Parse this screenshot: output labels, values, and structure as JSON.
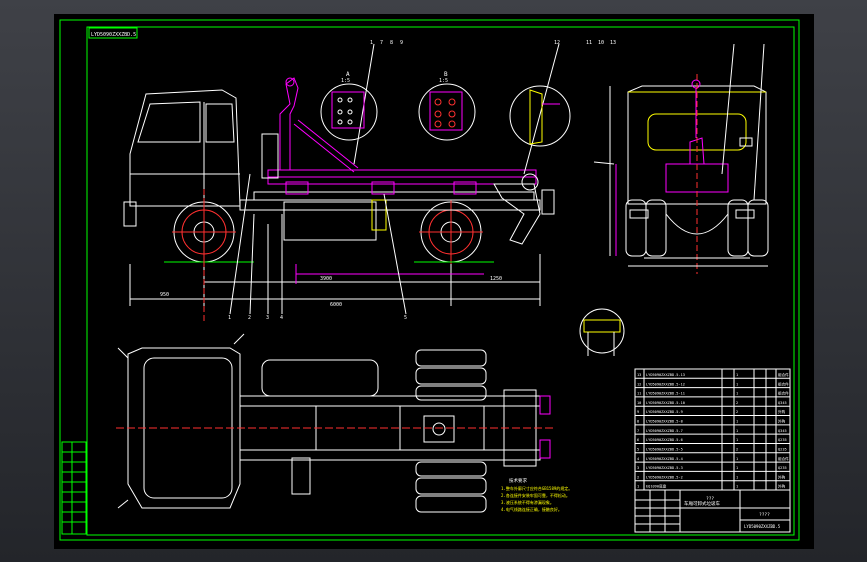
{
  "drawing": {
    "code_box": "LYD5090ZXXZBD.5",
    "detail_a": "A",
    "detail_b": "B",
    "scale": "1:5",
    "view_labels": [
      "1",
      "2",
      "3",
      "4",
      "5"
    ],
    "balloons_top_left": [
      "1",
      "7",
      "8",
      "9"
    ],
    "balloons_top_right": [
      "12",
      "11",
      "10",
      "13"
    ],
    "side_dims": [
      "950",
      "3900",
      "1250",
      "6000"
    ],
    "notes_title": "技术要求",
    "notes": [
      "1.整车外廓尺寸应符合GB1589的规定。",
      "2.各连接件安装牢固可靠，不得松动。",
      "3.液压系统不得有渗漏现象。",
      "4.电气线路连接正确，接触良好。"
    ],
    "title_block": {
      "name": "车厢可卸式垃圾车",
      "drawing_no": "LYD5090ZXXZBD.5",
      "marks": "???",
      "code": "????"
    },
    "bom_rows": [
      [
        "13",
        "LYD5090ZXXZBD.5-13",
        "拉臂钩总成",
        "1",
        "组合件"
      ],
      [
        "12",
        "LYD5090ZXXZBD.5-12",
        "中臂总成",
        "1",
        "组合件"
      ],
      [
        "11",
        "LYD5090ZXXZBD.5-11",
        "主臂总成",
        "1",
        "组合件"
      ],
      [
        "10",
        "LYD5090ZXXZBD.5-10",
        "锁紧机构",
        "2",
        "Q345"
      ],
      [
        "9",
        "LYD5090ZXXZBD.5-9",
        "翻转油缸",
        "2",
        "外购"
      ],
      [
        "8",
        "LYD5090ZXXZBD.5-8",
        "主油缸",
        "1",
        "外购"
      ],
      [
        "7",
        "LYD5090ZXXZBD.5-7",
        "副车架总成",
        "1",
        "Q345"
      ],
      [
        "6",
        "LYD5090ZXXZBD.5-6",
        "后防护装置",
        "1",
        "Q235"
      ],
      [
        "5",
        "LYD5090ZXXZBD.5-5",
        "侧防护装置",
        "2",
        "Q235"
      ],
      [
        "4",
        "LYD5090ZXXZBD.5-4",
        "液压系统",
        "1",
        "组合件"
      ],
      [
        "3",
        "LYD5090ZXXZBD.5-3",
        "油箱",
        "1",
        "Q235"
      ],
      [
        "2",
        "LYD5090ZXXZBD.5-2",
        "取力器",
        "1",
        "外购"
      ],
      [
        "1",
        "EQ1090底盘",
        "二类底盘",
        "1",
        "外购"
      ]
    ]
  }
}
